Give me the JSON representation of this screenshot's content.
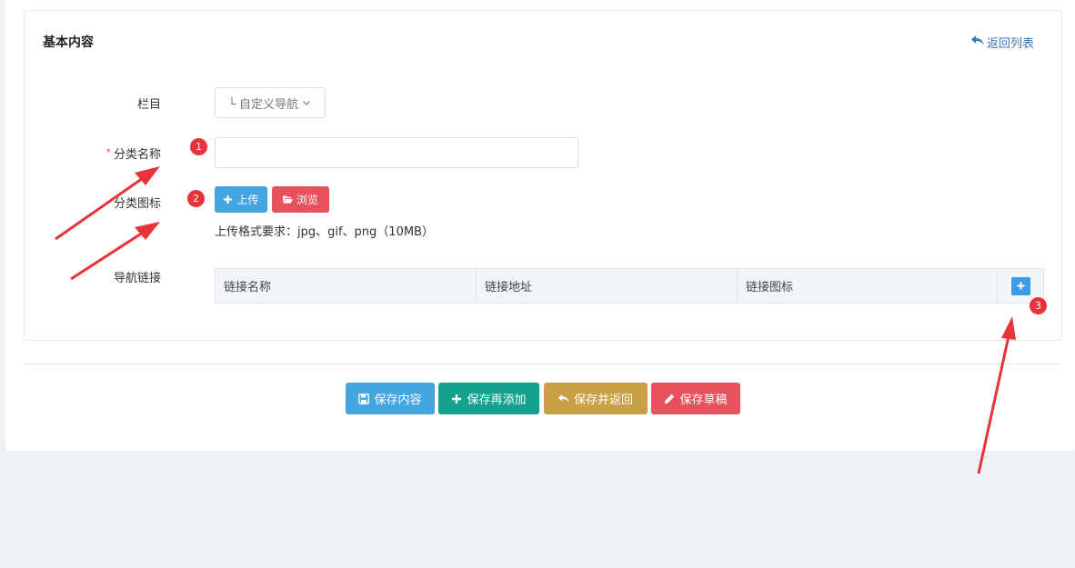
{
  "panel": {
    "title": "基本内容",
    "back_label": "返回列表"
  },
  "form": {
    "column_label": "栏目",
    "column_select_value": "└ 自定义导航",
    "required_mark": "*",
    "name_label": "分类名称",
    "name_value": "",
    "icon_label": "分类图标",
    "upload_label": "上传",
    "browse_label": "浏览",
    "upload_hint": "上传格式要求：jpg、gif、png（10MB）",
    "nav_links_label": "导航链接"
  },
  "table": {
    "headers": [
      "链接名称",
      "链接地址",
      "链接图标"
    ]
  },
  "footer": {
    "save_label": "保存内容",
    "save_add_label": "保存再添加",
    "save_return_label": "保存并返回",
    "save_draft_label": "保存草稿"
  },
  "annotations": {
    "badges": [
      "1",
      "2",
      "3"
    ],
    "color": "#e8333a"
  },
  "colors": {
    "blue": "#45a5e0",
    "red": "#e8505b",
    "teal": "#14a28f",
    "gold": "#c9a046",
    "link": "#3a77b8"
  }
}
